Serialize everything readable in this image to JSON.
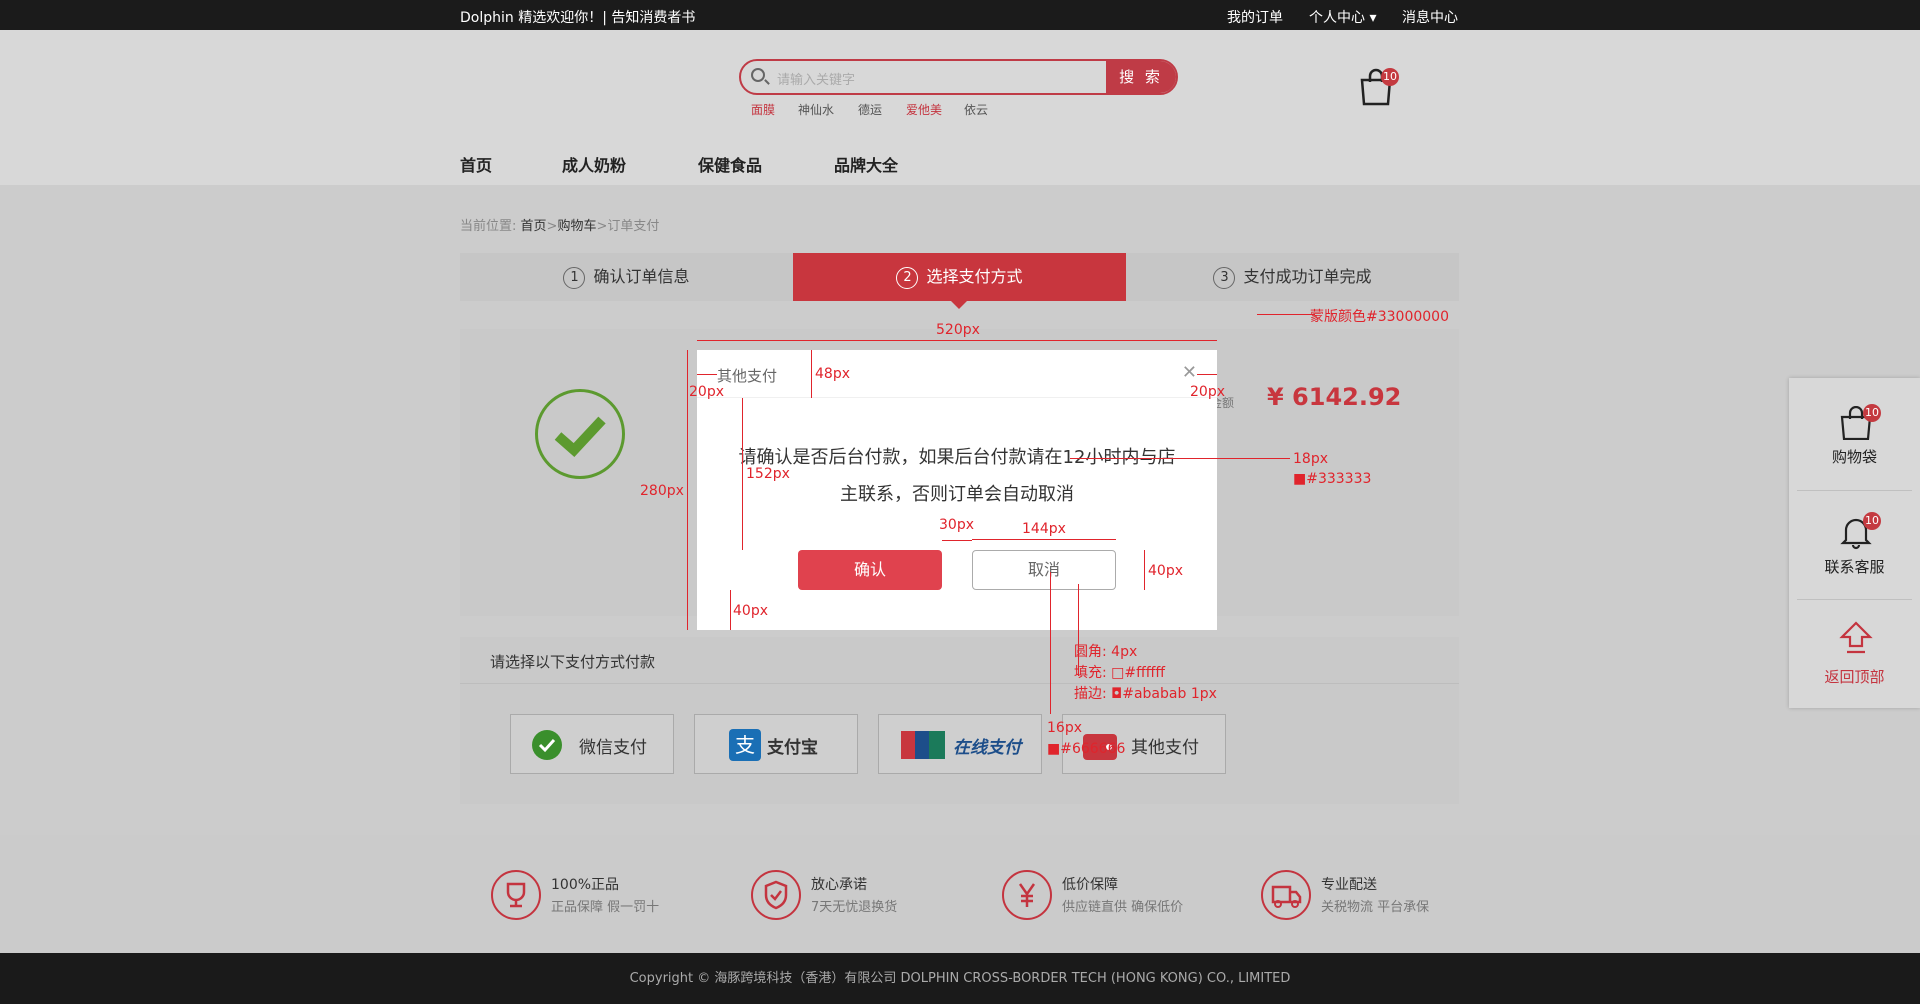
{
  "topbar": {
    "welcome": "Dolphin 精选欢迎你！| 告知消费者书",
    "orders": "我的订单",
    "personal": "个人中心 ▾",
    "messages": "消息中心"
  },
  "search": {
    "placeholder": "请输入关键字",
    "button": "搜 索",
    "hot": [
      "面膜",
      "神仙水",
      "德运",
      "爱他美",
      "依云"
    ]
  },
  "cart": {
    "count": "10"
  },
  "nav": [
    "首页",
    "成人奶粉",
    "保健食品",
    "品牌大全"
  ],
  "breadcrumb": {
    "prefix": "当前位置:",
    "home": "首页",
    "cart": "购物车",
    "current": "订单支付"
  },
  "steps": [
    {
      "num": "1",
      "label": "确认订单信息"
    },
    {
      "num": "2",
      "label": "选择支付方式"
    },
    {
      "num": "3",
      "label": "支付成功订单完成"
    }
  ],
  "order": {
    "amount": "¥ 6142.92",
    "amount_label": "金额"
  },
  "payment": {
    "title": "请选择以下支付方式付款",
    "methods": [
      "微信支付",
      "支付宝",
      "在线支付",
      "其他支付"
    ]
  },
  "features": [
    {
      "title": "100%正品",
      "desc": "正品保障  假一罚十"
    },
    {
      "title": "放心承诺",
      "desc": "7天无忧退换货"
    },
    {
      "title": "低价保障",
      "desc": "供应链直供  确保低价"
    },
    {
      "title": "专业配送",
      "desc": "关税物流 平台承保"
    }
  ],
  "footer": {
    "copyright": "Copyright ©  海豚跨境科技（香港）有限公司    DOLPHIN CROSS-BORDER TECH (HONG KONG) CO., LIMITED"
  },
  "sidebar": {
    "cart": "购物袋",
    "service": "联系客服",
    "top": "返回顶部",
    "cart_count": "10",
    "service_count": "10"
  },
  "dialog": {
    "title": "其他支付",
    "message": "请确认是否后台付款，如果后台付款请在12小时内与店主联系，否则订单会自动取消",
    "confirm": "确认",
    "cancel": "取消"
  },
  "annotations": {
    "mask": "蒙版颜色#33000000",
    "w520": "520px",
    "h48": "48px",
    "pad_l": "20px",
    "pad_r": "20px",
    "h152": "152px",
    "h280": "280px",
    "font18": "18px",
    "color333": "■#333333",
    "gap30": "30px",
    "w144": "144px",
    "h40": "40px",
    "b40": "40px",
    "radius": "圆角: 4px",
    "fill": "填充: □#ffffff",
    "stroke": "描边: ◘#ababab 1px",
    "font16": "16px",
    "color666": "■#666666"
  },
  "colors": {
    "accent": "#c8363e",
    "confirm": "#e0424e",
    "annotation": "#e0242c"
  }
}
